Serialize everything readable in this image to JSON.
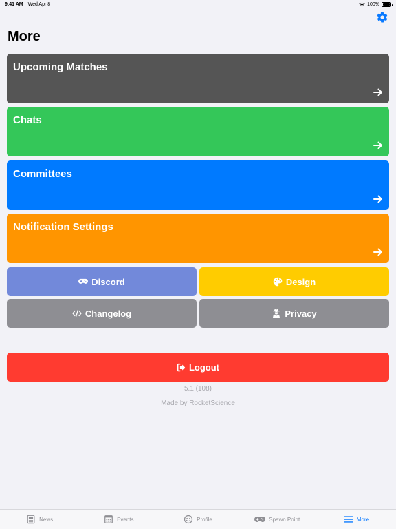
{
  "status_bar": {
    "time": "9:41 AM",
    "date": "Wed Apr 8",
    "battery": "100%"
  },
  "header": {
    "title": "More",
    "settings_icon": "gear-icon"
  },
  "cards": [
    {
      "label": "Upcoming Matches",
      "color": "#555555"
    },
    {
      "label": "Chats",
      "color": "#34c759"
    },
    {
      "label": "Committees",
      "color": "#007aff"
    },
    {
      "label": "Notification Settings",
      "color": "#ff9500"
    }
  ],
  "buttons": {
    "discord": {
      "label": "Discord",
      "color": "#7289da",
      "icon": "gamepad-icon"
    },
    "design": {
      "label": "Design",
      "color": "#ffcc00",
      "icon": "palette-icon"
    },
    "changelog": {
      "label": "Changelog",
      "color": "#8e8e93",
      "icon": "code-icon"
    },
    "privacy": {
      "label": "Privacy",
      "color": "#8e8e93",
      "icon": "user-secret-icon"
    },
    "logout": {
      "label": "Logout",
      "color": "#ff3b30",
      "icon": "sign-out-icon"
    }
  },
  "footer": {
    "version": "5.1 (108)",
    "credit": "Made by RocketScience"
  },
  "tabs": [
    {
      "label": "News",
      "icon": "newspaper-icon",
      "active": false
    },
    {
      "label": "Events",
      "icon": "calendar-icon",
      "active": false
    },
    {
      "label": "Profile",
      "icon": "smiley-icon",
      "active": false
    },
    {
      "label": "Spawn Point",
      "icon": "gamepad-icon",
      "active": false
    },
    {
      "label": "More",
      "icon": "menu-icon",
      "active": true
    }
  ],
  "accent_color": "#0a7aff"
}
